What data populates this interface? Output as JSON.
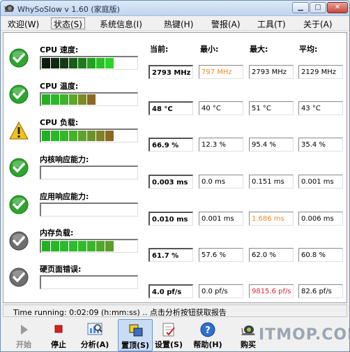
{
  "window": {
    "title": "WhySoSlow v 1.60  (家庭版)"
  },
  "menu": [
    {
      "label": "欢迎(W)"
    },
    {
      "label": "状态(S)"
    },
    {
      "label": "系统信息(I)"
    },
    {
      "label": "热键(H)"
    },
    {
      "label": "警报(A)"
    },
    {
      "label": "工具(T)"
    },
    {
      "label": "关于(A)"
    }
  ],
  "columns": {
    "current": "当前:",
    "min": "最小:",
    "max": "最大:",
    "avg": "平均:"
  },
  "rows": [
    {
      "label": "CPU 速度:",
      "status": "ok",
      "bar_level": 0.62,
      "bar_colors": [
        "#0e1a0e",
        "#102810",
        "#143a14",
        "#1a5a1a",
        "#1f7a1f",
        "#23a023",
        "#27c027",
        "#2ad22a"
      ],
      "current": "2793 MHz",
      "min": "797 MHz",
      "max": "2793 MHz",
      "avg": "2129 MHz",
      "highlight": "min-orange"
    },
    {
      "label": "CPU 温度:",
      "status": "ok",
      "bar_level": 0.48,
      "bar_colors": [
        "#22b022",
        "#2ab82a",
        "#3cb42a",
        "#5aa82a",
        "#7a8a25",
        "#8a6a22"
      ],
      "current": "48 °C",
      "min": "40 °C",
      "max": "51 °C",
      "avg": "43 °C",
      "highlight": "none"
    },
    {
      "label": "CPU 负载:",
      "status": "warning",
      "bar_level": 0.67,
      "bar_colors": [
        "#22b022",
        "#2ab82a",
        "#34b82a",
        "#48b02a",
        "#5ea22a",
        "#6e922a",
        "#7e8228",
        "#8a6a22"
      ],
      "current": "66.9 %",
      "min": "12.3 %",
      "max": "95.4 %",
      "avg": "35.4 %",
      "highlight": "none"
    },
    {
      "label": "内核响应能力:",
      "status": "ok",
      "bar_level": 0,
      "bar_colors": [],
      "current": "0.003 ms",
      "min": "0.0 ms",
      "max": "0.151 ms",
      "avg": "0.001 ms",
      "highlight": "none"
    },
    {
      "label": "应用响应能力:",
      "status": "ok",
      "bar_level": 0,
      "bar_colors": [],
      "current": "0.010 ms",
      "min": "0.001 ms",
      "max": "1.686 ms",
      "avg": "0.006 ms",
      "highlight": "max-orange"
    },
    {
      "label": "内存负载:",
      "status": "neutral",
      "bar_level": 0.62,
      "bar_colors": [
        "#22b022",
        "#26b626",
        "#2aba2a",
        "#2cbc2c",
        "#30bc2a",
        "#3cb42a",
        "#50a82a",
        "#5c9c2a"
      ],
      "current": "61.7 %",
      "min": "57.6 %",
      "max": "62.0 %",
      "avg": "60.8 %",
      "highlight": "none"
    },
    {
      "label": "硬页面错误:",
      "status": "neutral",
      "bar_level": 0,
      "bar_colors": [],
      "current": "4.0 pf/s",
      "min": "0.0 pf/s",
      "max": "9815.6 pf/s",
      "avg": "82.6 pf/s",
      "highlight": "max-red"
    }
  ],
  "status_bar": {
    "text": "Time running: 0:02:09  (h:mm:ss) ..  点击分析按钮获取报告"
  },
  "toolbar": [
    {
      "label": "开始",
      "icon": "play-icon",
      "state": "disabled"
    },
    {
      "label": "停止",
      "icon": "stop-icon",
      "state": "normal"
    },
    {
      "label": "分析(A)",
      "icon": "analyze-icon",
      "state": "normal"
    },
    {
      "label": "置顶(S)",
      "icon": "pin-top-icon",
      "state": "pressed"
    },
    {
      "label": "设置(S)",
      "icon": "settings-icon",
      "state": "normal"
    },
    {
      "label": "帮助(H)",
      "icon": "help-icon",
      "state": "normal"
    },
    {
      "label": "购买",
      "icon": "snail-icon",
      "state": "normal"
    }
  ],
  "watermark": "ITMOP.COM",
  "colors": {
    "ok_green": "#2ea52e",
    "warning_yellow": "#f1c21b",
    "neutral_gray": "#6e6e6e",
    "orange_value": "#f08a24",
    "red_value": "#e8233a"
  }
}
